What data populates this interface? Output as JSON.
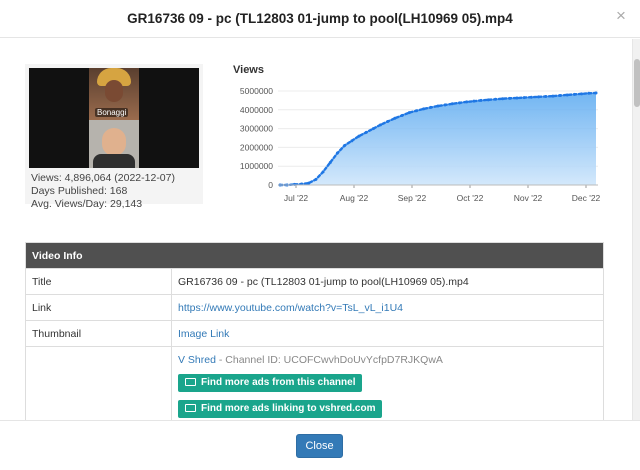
{
  "modal": {
    "title": "GR16736 09 - pc (TL12803 01-jump to pool(LH10969 05).mp4",
    "close_icon": "×",
    "close_label": "Close"
  },
  "thumbnail": {
    "caption_text": "Bonaggi"
  },
  "stats": {
    "views": "Views: 4,896,064 (2022-12-07)",
    "days": "Days Published: 168",
    "avg": "Avg. Views/Day: 29,143"
  },
  "chart_data": {
    "type": "area",
    "title": "Views",
    "y_ticks": [
      "5000000",
      "4000000",
      "3000000",
      "2000000",
      "1000000",
      "0"
    ],
    "ylim": [
      0,
      5000000
    ],
    "x_ticks": [
      "Jul '22",
      "Aug '22",
      "Sep '22",
      "Oct '22",
      "Nov '22",
      "Dec '22"
    ],
    "series": [
      {
        "color": "#1f77e4",
        "values": [
          0,
          0,
          30000,
          50000,
          100000,
          300000,
          700000,
          1200000,
          1700000,
          2100000,
          2350000,
          2600000,
          2800000,
          3000000,
          3200000,
          3380000,
          3550000,
          3700000,
          3850000,
          3950000,
          4050000,
          4130000,
          4200000,
          4260000,
          4320000,
          4370000,
          4420000,
          4460000,
          4500000,
          4530000,
          4560000,
          4590000,
          4610000,
          4630000,
          4650000,
          4670000,
          4690000,
          4710000,
          4730000,
          4760000,
          4790000,
          4820000,
          4850000,
          4880000,
          4896064
        ]
      }
    ],
    "grid": true,
    "legend": false
  },
  "video_info": {
    "header": "Video Info",
    "rows": [
      {
        "label": "Title",
        "value": "GR16736 09 - pc (TL12803 01-jump to pool(LH10969 05).mp4"
      },
      {
        "label": "Link",
        "value": "https://www.youtube.com/watch?v=TsL_vL_i1U4"
      },
      {
        "label": "Thumbnail",
        "value": "Image Link"
      }
    ],
    "channel_name": "V Shred",
    "channel_id": "- Channel ID: UCOFCwvhDoUvYcfpD7RJKQwA",
    "btn_more_ads": "Find more ads from this channel",
    "btn_more_links": "Find more ads linking to vshred.com"
  },
  "colors": {
    "accent": "#337ab7",
    "teal": "#1aa58c",
    "header_bg": "#505050"
  }
}
